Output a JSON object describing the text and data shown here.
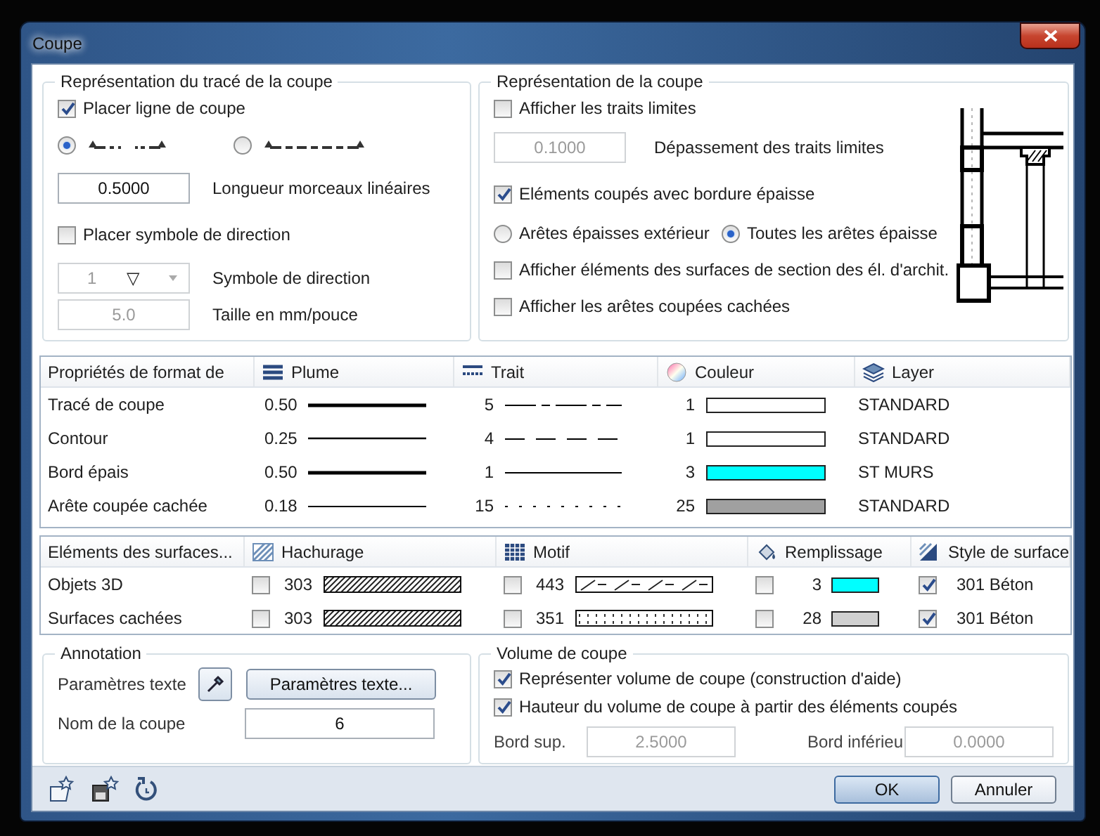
{
  "window": {
    "title": "Coupe"
  },
  "trace": {
    "title": "Représentation du tracé de la coupe",
    "place_line": {
      "label": "Placer ligne de coupe",
      "checked": true
    },
    "line_types": [
      {
        "kind": "short",
        "selected": true
      },
      {
        "kind": "long",
        "selected": false
      }
    ],
    "length": {
      "value": "0.5000",
      "label": "Longueur morceaux linéaires",
      "disabled": false
    },
    "place_symbol": {
      "label": "Placer symbole de direction",
      "checked": false
    },
    "symbol": {
      "value": "1",
      "glyph": "▽",
      "label": "Symbole de direction",
      "disabled": true
    },
    "size": {
      "value": "5.0",
      "label": "Taille en mm/pouce",
      "disabled": true
    }
  },
  "representation": {
    "title": "Représentation de la coupe",
    "show_limits": {
      "label": "Afficher les traits limites",
      "checked": false
    },
    "overhang": {
      "value": "0.1000",
      "label": "Dépassement des traits limites",
      "disabled": true
    },
    "thick_border": {
      "label": "Eléments coupés avec bordure épaisse",
      "checked": true
    },
    "edges": [
      {
        "label": "Arêtes épaisses extérieur",
        "selected": false
      },
      {
        "label": "Toutes les arêtes épaisse",
        "selected": true
      }
    ],
    "show_elements": {
      "label": "Afficher éléments des surfaces de section des él. d'archit.",
      "checked": false
    },
    "show_hidden": {
      "label": "Afficher les arêtes coupées cachées",
      "checked": false
    }
  },
  "format_table": {
    "columns": [
      {
        "label": "Propriétés de format de",
        "kind": "name"
      },
      {
        "label": "Plume",
        "kind": "pen"
      },
      {
        "label": "Trait",
        "kind": "line"
      },
      {
        "label": "Couleur",
        "kind": "color"
      },
      {
        "label": "Layer",
        "kind": "layer"
      }
    ],
    "rows": [
      {
        "name": "Tracé de coupe",
        "pen": "0.50",
        "line": {
          "value": "5",
          "kind": "dashdot"
        },
        "color_index": "1",
        "color": "#ffffff",
        "layer": "STANDARD"
      },
      {
        "name": "Contour",
        "pen": "0.25",
        "line": {
          "value": "4",
          "kind": "dashed"
        },
        "color_index": "1",
        "color": "#ffffff",
        "layer": "STANDARD"
      },
      {
        "name": "Bord épais",
        "pen": "0.50",
        "line": {
          "value": "1",
          "kind": "solid"
        },
        "color_index": "3",
        "color": "#00ffff",
        "layer": "ST MURS"
      },
      {
        "name": "Arête coupée cachée",
        "pen": "0.18",
        "line": {
          "value": "15",
          "kind": "dotted"
        },
        "color_index": "25",
        "color": "#a0a0a0",
        "layer": "STANDARD"
      }
    ]
  },
  "surfaces_table": {
    "columns": [
      {
        "label": "Eléments des surfaces...",
        "kind": "name"
      },
      {
        "label": "Hachurage",
        "kind": "hatch"
      },
      {
        "label": "Motif",
        "kind": "motif"
      },
      {
        "label": "Remplissage",
        "kind": "fill"
      },
      {
        "label": "Style de surface",
        "kind": "style"
      }
    ],
    "rows": [
      {
        "name": "Objets 3D",
        "hatch": {
          "checked": false,
          "value": "303",
          "kind": "diagonal"
        },
        "motif": {
          "checked": false,
          "value": "443",
          "kind": "slash"
        },
        "fill": {
          "checked": false,
          "value": "3",
          "color": "#00ffff"
        },
        "style": {
          "checked": true,
          "value": "301 Béton"
        }
      },
      {
        "name": "Surfaces cachées",
        "hatch": {
          "checked": false,
          "value": "303",
          "kind": "diagonal"
        },
        "motif": {
          "checked": false,
          "value": "351",
          "kind": "dots"
        },
        "fill": {
          "checked": false,
          "value": "28",
          "color": "#d0d0d0"
        },
        "style": {
          "checked": true,
          "value": "301 Béton"
        }
      }
    ]
  },
  "annotation": {
    "title": "Annotation",
    "text_params_label": "Paramètres texte",
    "text_params_button": "Paramètres texte...",
    "name_label": "Nom de la coupe",
    "name_value": "6"
  },
  "volume": {
    "title": "Volume de coupe",
    "options": [
      {
        "label": "Représenter volume de coupe (construction d'aide)",
        "checked": true
      },
      {
        "label": "Hauteur du volume de coupe à partir des éléments coupés",
        "checked": true
      }
    ],
    "top": {
      "label": "Bord sup.",
      "value": "2.5000",
      "disabled": true
    },
    "bottom": {
      "label": "Bord inférieu",
      "value": "0.0000",
      "disabled": true
    }
  },
  "buttons": [
    {
      "label": "OK",
      "kind": "default"
    },
    {
      "label": "Annuler",
      "kind": "normal"
    }
  ]
}
